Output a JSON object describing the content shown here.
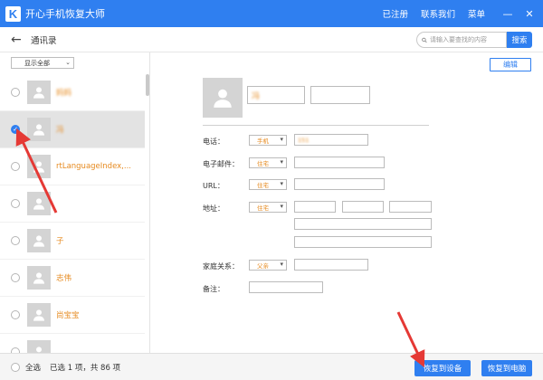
{
  "app": {
    "title": "开心手机恢复大师",
    "logo_letter": "K",
    "registered": "已注册",
    "contact_us": "联系我们",
    "menu": "菜单",
    "minimize": "—",
    "close": "✕"
  },
  "toolbar": {
    "back": "←",
    "page_title": "通讯录",
    "search_placeholder": "请输入要查找的内容",
    "search_button": "搜索"
  },
  "list": {
    "filter_label": "显示全部",
    "contacts": [
      {
        "name": "妈妈",
        "selected": false,
        "blurred": true
      },
      {
        "name": "冯",
        "selected": true,
        "blurred": true
      },
      {
        "name": "rtLanguageIndex,...",
        "selected": false,
        "blurred": false
      },
      {
        "name": "",
        "selected": false,
        "blurred": false
      },
      {
        "name": "子",
        "selected": false,
        "blurred": false
      },
      {
        "name": "志伟",
        "selected": false,
        "blurred": false
      },
      {
        "name": "尚宝宝",
        "selected": false,
        "blurred": false
      },
      {
        "name": "",
        "selected": false,
        "blurred": false
      }
    ]
  },
  "detail": {
    "edit": "编辑",
    "first_name": "冯",
    "phone_label": "电话：",
    "phone_type": "手机",
    "phone_value": "151",
    "email_label": "电子邮件：",
    "email_type": "住宅",
    "url_label": "URL：",
    "url_type": "住宅",
    "address_label": "地址：",
    "address_type": "住宅",
    "family_label": "家庭关系：",
    "family_type": "父亲",
    "note_label": "备注："
  },
  "bottom": {
    "select_all": "全选",
    "selected_info": "已选 1 项，共 86 项",
    "restore_device": "恢复到设备",
    "restore_pc": "恢复到电脑"
  },
  "colors": {
    "brand": "#2f7ff0",
    "name_text": "#e68a1f",
    "annotation": "#e53935"
  }
}
